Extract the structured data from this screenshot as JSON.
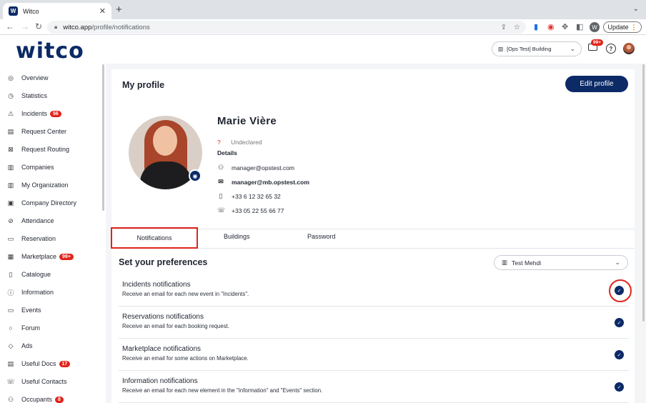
{
  "browser": {
    "tab_title": "Witco",
    "favicon_letter": "W",
    "url_host": "witco.app",
    "url_path": "/profile/notifications",
    "profile_letter": "W",
    "update_label": "Update"
  },
  "header": {
    "logo": "witco",
    "building": "[Ops Test] Building",
    "notif_badge": "99+"
  },
  "sidebar": {
    "items": [
      {
        "label": "Overview",
        "icon": "eye-icon",
        "glyph": "◎",
        "count": ""
      },
      {
        "label": "Statistics",
        "icon": "clock-icon",
        "glyph": "◷",
        "count": ""
      },
      {
        "label": "Incidents",
        "icon": "warning-icon",
        "glyph": "⚠",
        "count": "56"
      },
      {
        "label": "Request Center",
        "icon": "inbox-icon",
        "glyph": "▤",
        "count": ""
      },
      {
        "label": "Request Routing",
        "icon": "routing-icon",
        "glyph": "⊠",
        "count": ""
      },
      {
        "label": "Companies",
        "icon": "building-icon",
        "glyph": "▥",
        "count": ""
      },
      {
        "label": "My Organization",
        "icon": "organization-icon",
        "glyph": "▥",
        "count": ""
      },
      {
        "label": "Company Directory",
        "icon": "directory-icon",
        "glyph": "▣",
        "count": ""
      },
      {
        "label": "Attendance",
        "icon": "check-circle-icon",
        "glyph": "⊘",
        "count": ""
      },
      {
        "label": "Reservation",
        "icon": "calendar-icon",
        "glyph": "▭",
        "count": ""
      },
      {
        "label": "Marketplace",
        "icon": "store-icon",
        "glyph": "▦",
        "count": "99+"
      },
      {
        "label": "Catalogue",
        "icon": "book-icon",
        "glyph": "▯",
        "count": ""
      },
      {
        "label": "Information",
        "icon": "info-icon",
        "glyph": "ⓘ",
        "count": ""
      },
      {
        "label": "Events",
        "icon": "event-icon",
        "glyph": "▭",
        "count": ""
      },
      {
        "label": "Forum",
        "icon": "chat-icon",
        "glyph": "○",
        "count": ""
      },
      {
        "label": "Ads",
        "icon": "tag-icon",
        "glyph": "◇",
        "count": ""
      },
      {
        "label": "Useful Docs",
        "icon": "document-icon",
        "glyph": "▤",
        "count": "17"
      },
      {
        "label": "Useful Contacts",
        "icon": "phone-icon",
        "glyph": "☏",
        "count": ""
      },
      {
        "label": "Occupants",
        "icon": "people-icon",
        "glyph": "⚇",
        "count": "8"
      }
    ]
  },
  "profile": {
    "page_title": "My profile",
    "edit_label": "Edit profile",
    "name": "Marie Vière",
    "gender_icon": "?",
    "gender": "Undeclared",
    "details_label": "Details",
    "email1": "manager@opstest.com",
    "email2": "manager@mb.opstest.com",
    "mobile": "+33 6 12 32 65 32",
    "phone": "+33 05 22 55 66 77"
  },
  "tabs": [
    "Notifications",
    "Buildings",
    "Password"
  ],
  "preferences": {
    "title": "Set your preferences",
    "site": "Test Mehdi",
    "rows": [
      {
        "title": "Incidents notifications",
        "desc": "Receive an email for each new event in \"Incidents\".",
        "checked": true
      },
      {
        "title": "Reservations notifications",
        "desc": "Receive an email for each booking request.",
        "checked": true
      },
      {
        "title": "Marketplace notifications",
        "desc": "Receive an email for some actions on Marketplace.",
        "checked": true
      },
      {
        "title": "Information notifications",
        "desc": "Receive an email for each new element in the \"Information\" and \"Events\" section.",
        "checked": true
      }
    ]
  },
  "colors": {
    "brand": "#0b2a66",
    "alert": "#e0241b"
  }
}
